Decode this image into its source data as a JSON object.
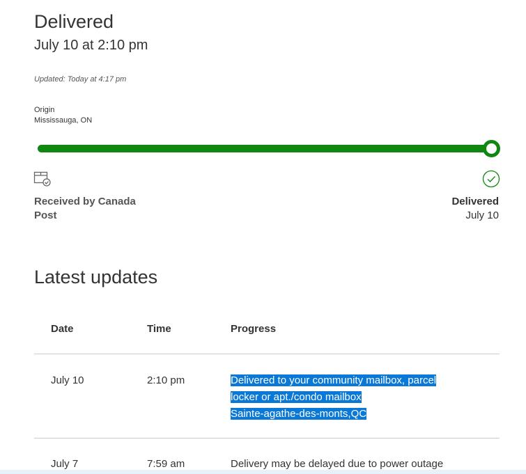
{
  "status": {
    "title": "Delivered",
    "date_time": "July 10 at 2:10 pm",
    "updated": "Updated: Today at 4:17 pm"
  },
  "origin": {
    "label": "Origin",
    "value": "Mississauga, ON"
  },
  "progress": {
    "fraction": 1.0,
    "color": "#10880f",
    "start_label": "Received by Canada Post",
    "end_label": "Delivered",
    "end_date": "July 10",
    "start_icon": "package-check-icon",
    "end_icon": "check-circle-icon"
  },
  "latest_updates": {
    "title": "Latest updates",
    "columns": [
      "Date",
      "Time",
      "Progress"
    ],
    "rows": [
      {
        "date": "July 10",
        "time": "2:10 pm",
        "progress_lines": [
          "Delivered to your community mailbox, parcel",
          "locker or apt./condo mailbox",
          "Sainte-agathe-des-monts,QC"
        ]
      },
      {
        "date": "July 7",
        "time": "7:59 am",
        "progress_lines": [
          "Delivery may be delayed due to power outage"
        ]
      }
    ]
  },
  "colors": {
    "accent_green": "#10880f",
    "selection_blue": "#0a78d6",
    "divider": "#cccccc"
  }
}
